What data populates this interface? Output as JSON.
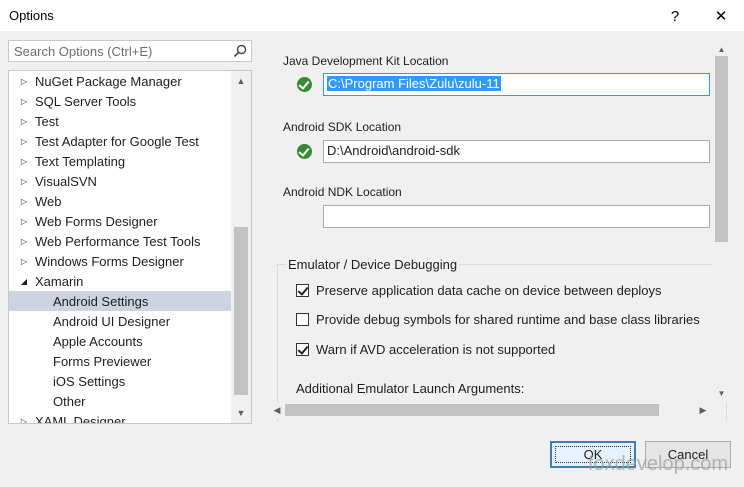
{
  "window": {
    "title": "Options",
    "help_glyph": "?",
    "close_glyph": "✕"
  },
  "search": {
    "placeholder": "Search Options (Ctrl+E)",
    "value": ""
  },
  "tree": {
    "items": [
      {
        "label": "NuGet Package Manager",
        "expanded": false,
        "level": 0
      },
      {
        "label": "SQL Server Tools",
        "expanded": false,
        "level": 0
      },
      {
        "label": "Test",
        "expanded": false,
        "level": 0
      },
      {
        "label": "Test Adapter for Google Test",
        "expanded": false,
        "level": 0
      },
      {
        "label": "Text Templating",
        "expanded": false,
        "level": 0
      },
      {
        "label": "VisualSVN",
        "expanded": false,
        "level": 0
      },
      {
        "label": "Web",
        "expanded": false,
        "level": 0
      },
      {
        "label": "Web Forms Designer",
        "expanded": false,
        "level": 0
      },
      {
        "label": "Web Performance Test Tools",
        "expanded": false,
        "level": 0
      },
      {
        "label": "Windows Forms Designer",
        "expanded": false,
        "level": 0
      },
      {
        "label": "Xamarin",
        "expanded": true,
        "level": 0
      },
      {
        "label": "Android Settings",
        "level": 1,
        "selected": true
      },
      {
        "label": "Android UI Designer",
        "level": 1
      },
      {
        "label": "Apple Accounts",
        "level": 1
      },
      {
        "label": "Forms Previewer",
        "level": 1
      },
      {
        "label": "iOS Settings",
        "level": 1
      },
      {
        "label": "Other",
        "level": 1
      },
      {
        "label": "XAML Designer",
        "expanded": false,
        "level": 0
      }
    ]
  },
  "settings": {
    "jdk_label": "Java Development Kit Location",
    "jdk_value": "C:\\Program Files\\Zulu\\zulu-11",
    "sdk_label": "Android SDK Location",
    "sdk_value": "D:\\Android\\android-sdk",
    "ndk_label": "Android NDK Location",
    "ndk_value": "",
    "emulator_group_title": "Emulator / Device Debugging",
    "checkboxes": [
      {
        "label": "Preserve application data cache on device between deploys",
        "checked": true
      },
      {
        "label": "Provide debug symbols for shared runtime and base class libraries",
        "checked": false
      },
      {
        "label": "Warn if AVD acceleration is not supported",
        "checked": true
      }
    ],
    "extra_args_label": "Additional Emulator Launch Arguments:"
  },
  "buttons": {
    "ok_label": "OK",
    "cancel_label": "Cancel"
  },
  "watermark": "foxdevelop.com",
  "colors": {
    "selection": "#cdd3e1",
    "accent": "#3399ff",
    "success": "#388a34"
  }
}
